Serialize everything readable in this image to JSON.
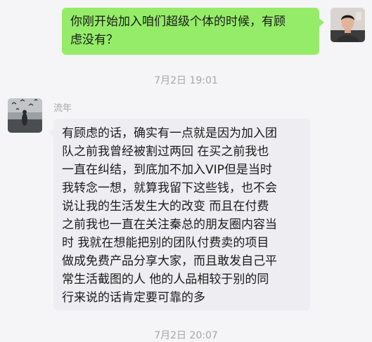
{
  "chat": {
    "messages": [
      {
        "direction": "outgoing",
        "text": "你刚开始加入咱们超级个体的时候，有顾\n虑没有？",
        "bubble_color": "#95ec69"
      },
      {
        "direction": "incoming",
        "sender": "流年",
        "text": "有顾虑的话，确实有一点就是因为加入团\n队之前我曾经被割过两回 在买之前我也\n一直在纠结，到底加不加入VIP但是当时\n我转念一想，就算我留下这些钱，也不会\n说让我的生活发生大的改变 而且在付费\n之前我也一直在关注秦总的朋友圈内容当\n时 我就在想能把别的团队付费卖的项目\n做成免费产品分享大家，而且敢发自己平\n常生活截图的人 他的人品相较于别的同\n行来说的话肯定要可靠的多",
        "bubble_color": "#eeeef2"
      }
    ],
    "timestamps": [
      "7月2日 19:01",
      "7月2日 20:07"
    ]
  }
}
